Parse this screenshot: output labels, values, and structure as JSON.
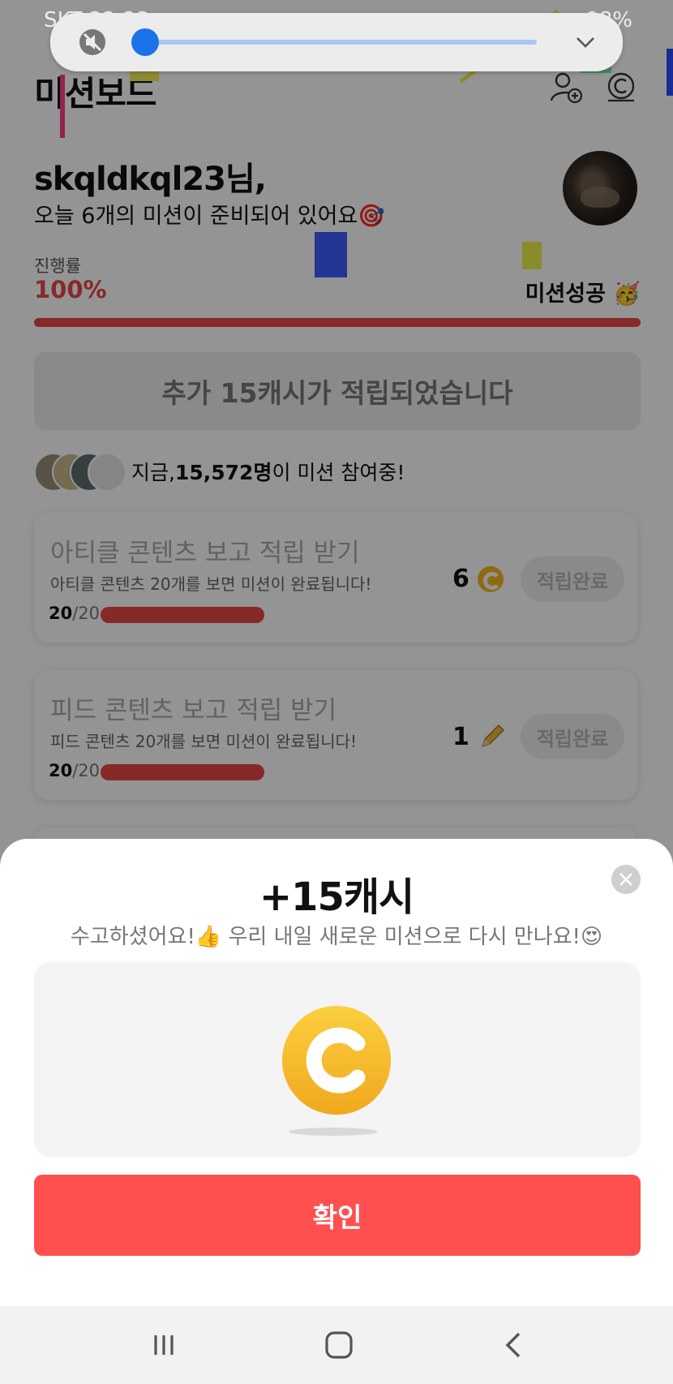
{
  "status_bar": {
    "carrier_time": "SKT 22:23",
    "battery": "98%"
  },
  "header": {
    "title": "미션보드",
    "icons": [
      "add-friend-icon",
      "cash-coin-icon"
    ]
  },
  "greeting": {
    "name": "skqldkql23님,",
    "subtitle": "오늘 6개의 미션이 준비되어 있어요🎯"
  },
  "progress": {
    "label": "진행률",
    "value": "100%",
    "fraction": 1.0,
    "success_text": "미션성공 🥳"
  },
  "bonus_banner": "추가 15캐시가 적립되었습니다",
  "participants": {
    "prefix": "지금, ",
    "count": "15,572명",
    "suffix": "이 미션 참여중!"
  },
  "missions": [
    {
      "title": "아티클 콘텐츠 보고 적립 받기",
      "desc": "아티클 콘텐츠 20개를 보면 미션이 완료됩니다!",
      "done": "20",
      "total": "/20",
      "reward": "6",
      "reward_icon": "coin-icon",
      "button": "적립완료"
    },
    {
      "title": "피드 콘텐츠 보고 적립 받기",
      "desc": "피드 콘텐츠 20개를 보면 미션이 완료됩니다!",
      "done": "20",
      "total": "/20",
      "reward": "1",
      "reward_icon": "pencil-icon",
      "button": "적립완료"
    }
  ],
  "sheet": {
    "title": "+15캐시",
    "message": "수고하셨어요!👍 우리 내일 새로운 미션으로 다시 만나요!😍",
    "confirm": "확인"
  },
  "colors": {
    "accent": "#e84747",
    "confirm": "#ff4f4f",
    "coin": "#f5b820",
    "media_knob": "#1a73e8"
  }
}
